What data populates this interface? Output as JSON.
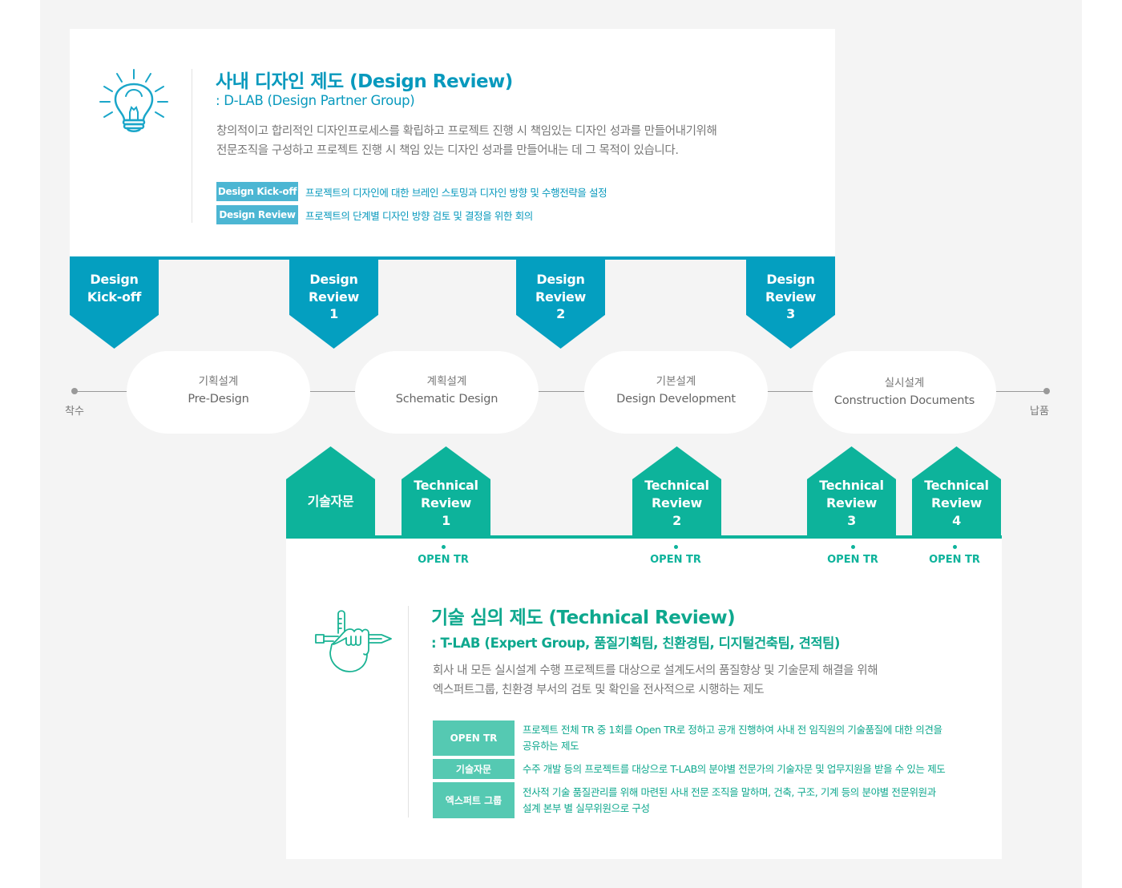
{
  "design_review": {
    "title": "사내 디자인 제도 (Design Review)",
    "subtitle": ": D-LAB (Design Partner Group)",
    "description": [
      "창의적이고 합리적인 디자인프로세스를 확립하고 프로젝트 진행 시 책임있는 디자인 성과를 만들어내기위해",
      "전문조직을 구성하고 프로젝트 진행 시 책임 있는 디자인 성과를 만들어내는 데 그 목적이 있습니다."
    ],
    "definitions": [
      {
        "term": "Design Kick-off",
        "text": "프로젝트의 디자인에 대한 브레인 스토밍과 디자인 방향 및 수행전략을 설정"
      },
      {
        "term": "Design Review",
        "text": "프로젝트의 단계별 디자인 방향 검토 및 결정을 위한 회의"
      }
    ],
    "icon": "lightbulb-icon",
    "accent_color": "#049fc0"
  },
  "design_markers": [
    {
      "lines": [
        "Design",
        "Kick-off"
      ]
    },
    {
      "lines": [
        "Design",
        "Review",
        "1"
      ]
    },
    {
      "lines": [
        "Design",
        "Review",
        "2"
      ]
    },
    {
      "lines": [
        "Design",
        "Review",
        "3"
      ]
    }
  ],
  "timeline": {
    "start_label": "착수",
    "end_label": "납품",
    "phases": [
      {
        "ko": "기획설계",
        "en": "Pre-Design"
      },
      {
        "ko": "계획설계",
        "en": "Schematic Design"
      },
      {
        "ko": "기본설계",
        "en": "Design Development"
      },
      {
        "ko": "실시설계",
        "en": "Construction Documents"
      }
    ]
  },
  "technical_markers": [
    {
      "lines": [
        "기술자문"
      ]
    },
    {
      "lines": [
        "Technical",
        "Review",
        "1"
      ],
      "open_tr": "OPEN TR"
    },
    {
      "lines": [
        "Technical",
        "Review",
        "2"
      ],
      "open_tr": "OPEN TR"
    },
    {
      "lines": [
        "Technical",
        "Review",
        "3"
      ],
      "open_tr": "OPEN TR"
    },
    {
      "lines": [
        "Technical",
        "Review",
        "4"
      ],
      "open_tr": "OPEN TR"
    }
  ],
  "technical_review": {
    "title": "기술 심의 제도 (Technical Review)",
    "subtitle": ": T-LAB (Expert Group, 품질기획팀, 친환경팀, 디지털건축팀, 견적팀)",
    "description": [
      "회사 내 모든 실시설계 수행 프로젝트를 대상으로 설계도서의 품질향상 및 기술문제 해결을 위해",
      "엑스퍼트그룹, 친환경 부서의 검토 및 확인을 전사적으로 시행하는 제도"
    ],
    "definitions": [
      {
        "term": "OPEN TR",
        "text": [
          "프로젝트 전체 TR 중 1회를 Open TR로 정하고 공개 진행하여 사내 전 임직원의 기술품질에 대한 의견을",
          "공유하는 제도"
        ]
      },
      {
        "term": "기술자문",
        "text": [
          "수주 개발 등의 프로젝트를 대상으로 T-LAB의 분야별 전문가의 기술자문 및 업무지원을 받을 수 있는 제도"
        ]
      },
      {
        "term": "엑스퍼트 그룹",
        "text": [
          "전사적 기술 품질관리를 위해 마련된 사내 전문 조직을 말하며, 건축, 구조, 기계 등의 분야별 전문위원과",
          "설계 본부 별 실무위원으로 구성"
        ]
      }
    ],
    "icon": "hand-pencil-icon",
    "accent_color": "#0db39b"
  }
}
